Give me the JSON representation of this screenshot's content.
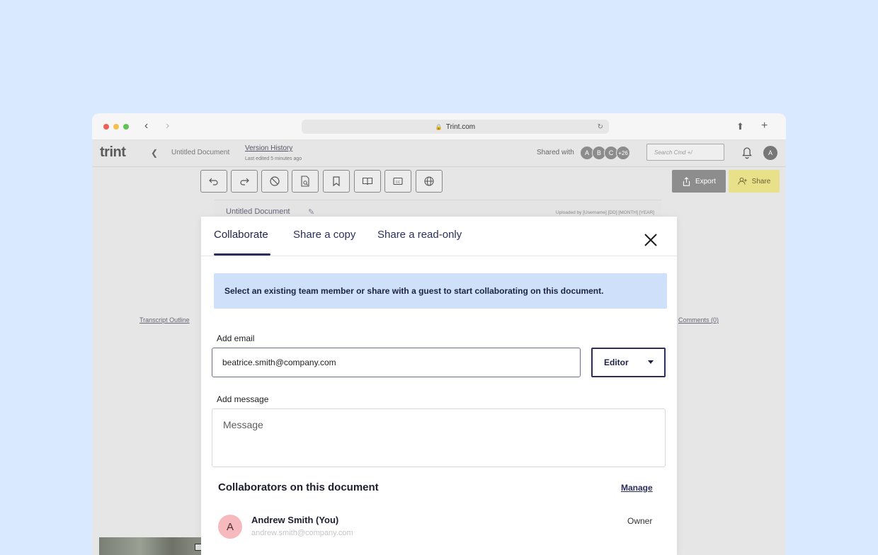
{
  "browser": {
    "url": "Trint.com"
  },
  "header": {
    "logo": "trint",
    "doc_name": "Untitled Document",
    "version_history": "Version History",
    "last_edited": "Last edited 5 minutes ago",
    "shared_with_label": "Shared with",
    "shared_avatars": [
      "A",
      "B",
      "C",
      "+26"
    ],
    "search_placeholder": "Search Cmd +/",
    "user_initial": "A"
  },
  "toolbar": {
    "export_label": "Export",
    "share_label": "Share"
  },
  "document": {
    "title": "Untitled Document",
    "uploaded": "Uploaded by [Username]  [DD] [MONTH] [YEAR]",
    "transcript_outline": "Transcript Outline",
    "comments": "Comments (0)"
  },
  "modal": {
    "tabs": [
      "Collaborate",
      "Share a copy",
      "Share a read-only"
    ],
    "banner": "Select an existing team member or share with a guest to start collaborating on this document.",
    "email_label": "Add email",
    "email_value": "beatrice.smith@company.com",
    "role": "Editor",
    "message_label": "Add message",
    "message_placeholder": "Message",
    "collaborators_heading": "Collaborators on this document",
    "manage_label": "Manage",
    "collaborators": [
      {
        "initial": "A",
        "name": "Andrew Smith (You)",
        "email": "andrew.smith@company.com",
        "role": "Owner"
      }
    ]
  },
  "colors": {
    "page_background": "#d9e9ff",
    "accent_navy": "#2b2e5c",
    "banner_blue": "#cfe0fb",
    "share_yellow": "#e9e18a",
    "avatar_pink": "#f6b9bd"
  }
}
